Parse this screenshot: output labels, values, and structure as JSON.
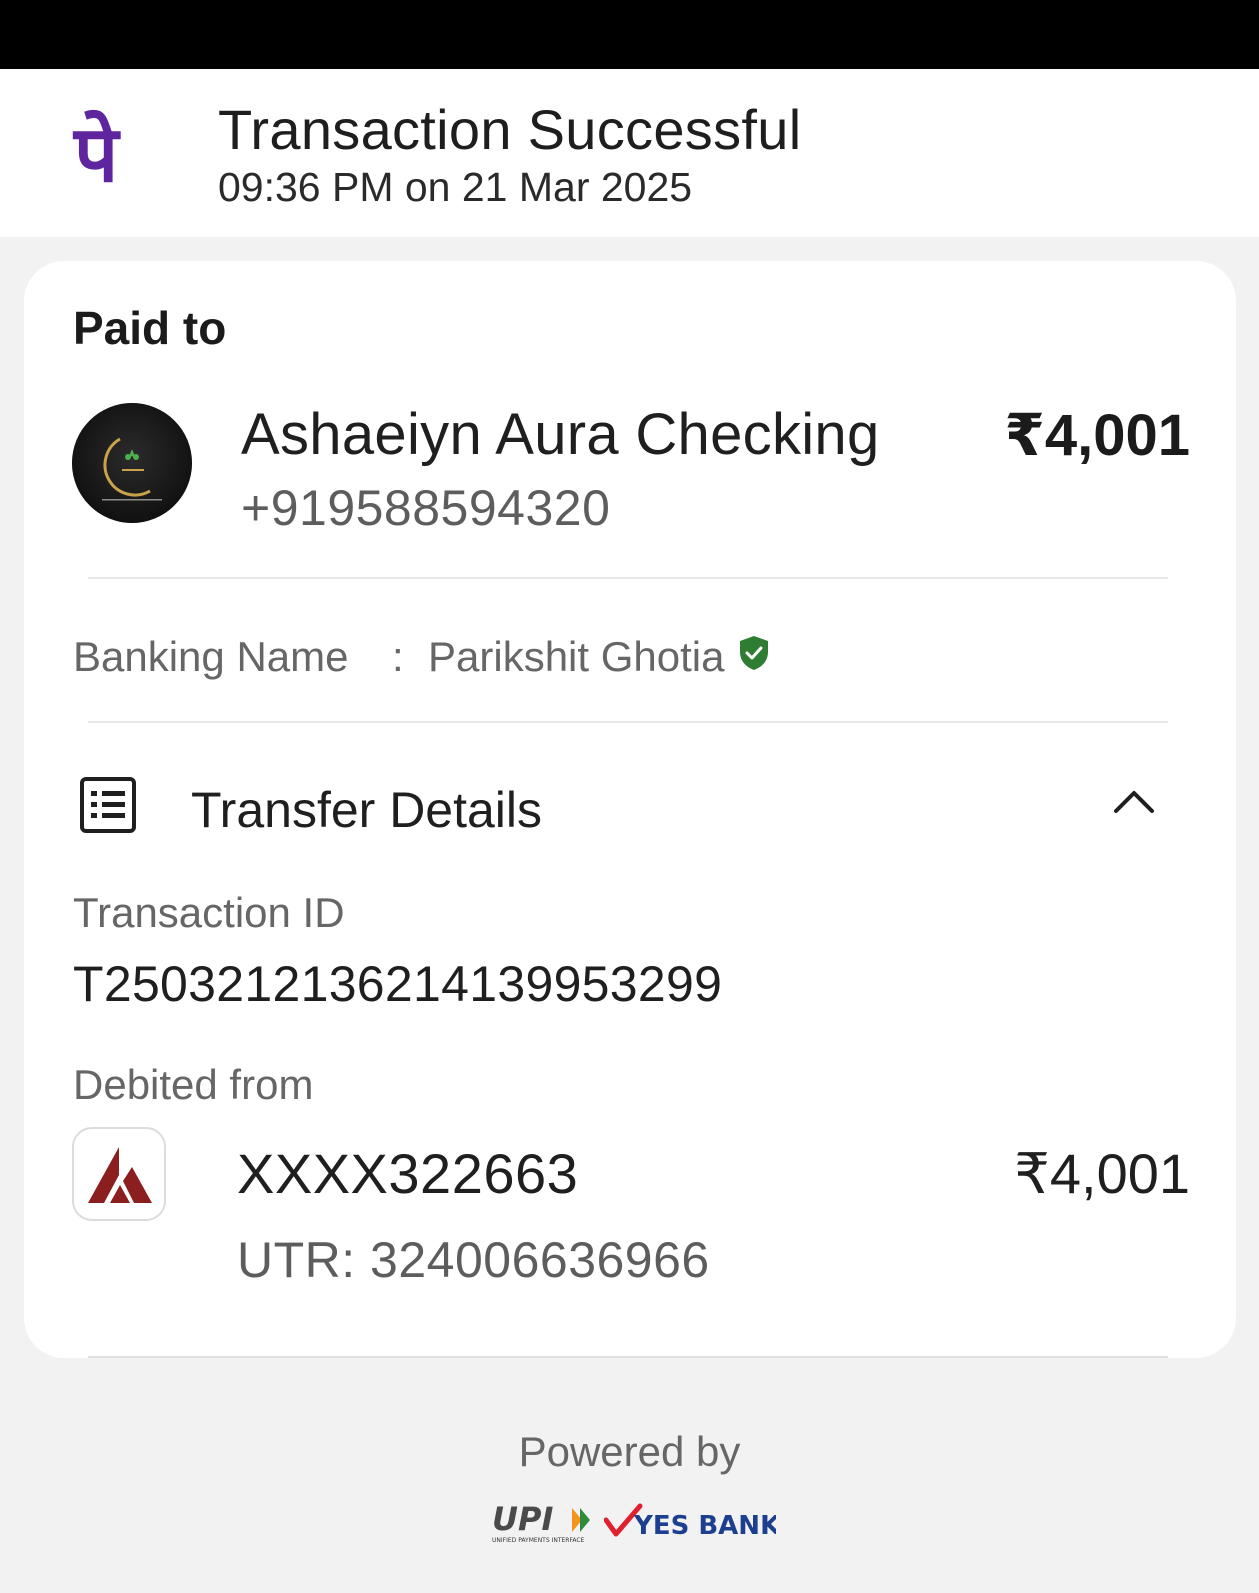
{
  "colors": {
    "brand_purple": "#5f259f",
    "verified_green": "#2e7d32",
    "bank_red": "#8b1e1e",
    "yes_red": "#e0202e",
    "yes_blue": "#1d3f8f"
  },
  "header": {
    "logo_icon": "phonepe-logo",
    "logo_glyph": "पे",
    "title": "Transaction Successful",
    "datetime": "09:36 PM on 21 Mar 2025"
  },
  "paid_to": {
    "section_label": "Paid to",
    "avatar_icon": "ashaeiyn-logo",
    "name": "Ashaeiyn Aura Checking",
    "phone": "+919588594320",
    "amount": "₹4,001"
  },
  "banking": {
    "label": "Banking Name",
    "colon": ":",
    "name": "Parikshit Ghotia",
    "verified_icon": "verified-shield-icon"
  },
  "transfer": {
    "icon": "receipt-list-icon",
    "title": "Transfer Details",
    "toggle_icon": "chevron-up-icon",
    "transaction_id_label": "Transaction ID",
    "transaction_id": "T2503212136214139953299",
    "debited_label": "Debited from",
    "bank_icon": "axis-bank-icon",
    "account": "XXXX322663",
    "debit_amount": "₹4,001",
    "utr": "UTR: 324006636966"
  },
  "footer": {
    "powered_by": "Powered by",
    "upi_logo": "upi-logo",
    "upi_text": "UPI",
    "upi_subtext": "UNIFIED PAYMENTS INTERFACE",
    "yes_logo": "yes-bank-logo",
    "yes_text": "YES BANK"
  }
}
